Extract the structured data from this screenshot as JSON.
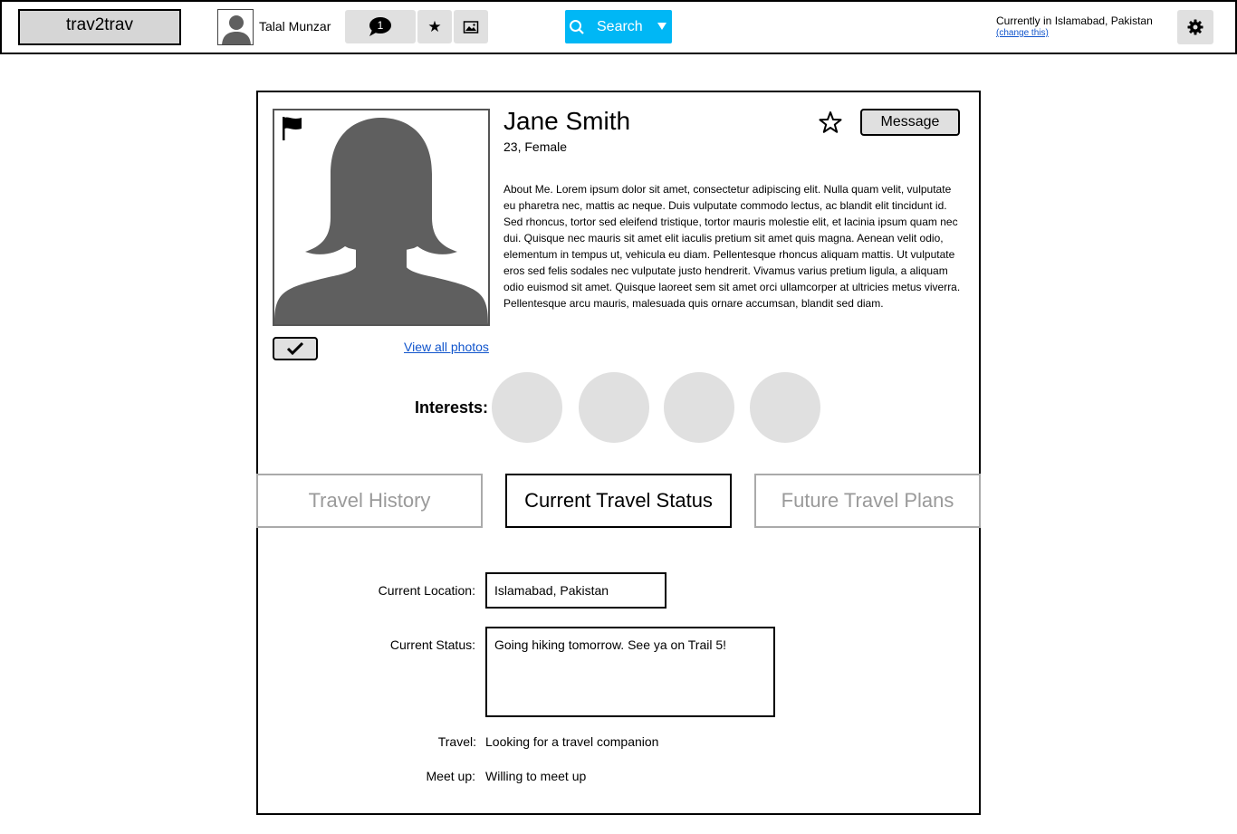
{
  "topbar": {
    "logo": "trav2trav",
    "user_name": "Talal Munzar",
    "message_count": "1",
    "search_label": "Search",
    "location_text": "Currently in Islamabad, Pakistan",
    "change_link": "(change this)"
  },
  "profile": {
    "name": "Jane Smith",
    "meta": "23, Female",
    "message_button": "Message",
    "view_photos": "View all photos",
    "about": "About Me. Lorem ipsum dolor sit amet, consectetur adipiscing elit. Nulla quam velit, vulputate eu pharetra nec, mattis ac neque. Duis vulputate commodo lectus, ac blandit elit tincidunt id. Sed rhoncus, tortor sed eleifend tristique, tortor mauris molestie elit, et lacinia ipsum quam nec dui. Quisque nec mauris sit amet elit iaculis pretium sit amet quis magna. Aenean velit odio, elementum in tempus ut, vehicula eu diam. Pellentesque rhoncus aliquam mattis. Ut vulputate eros sed felis sodales nec vulputate justo hendrerit. Vivamus varius pretium ligula, a aliquam odio euismod sit amet. Quisque laoreet sem sit amet orci ullamcorper at ultricies metus viverra. Pellentesque arcu mauris, malesuada quis ornare accumsan, blandit sed diam.",
    "interests_label": "Interests:"
  },
  "tabs": [
    {
      "label": "Travel History",
      "active": false
    },
    {
      "label": "Current Travel Status",
      "active": true
    },
    {
      "label": "Future Travel Plans",
      "active": false
    }
  ],
  "status_form": {
    "location_label": "Current Location:",
    "location_value": "Islamabad, Pakistan",
    "status_label": "Current Status:",
    "status_value": "Going hiking tomorrow. See ya on Trail 5!",
    "travel_label": "Travel:",
    "travel_value": "Looking for a travel companion",
    "meetup_label": "Meet up:",
    "meetup_value": "Willing to meet up"
  },
  "colors": {
    "search_accent": "#00b7f5",
    "button_gray": "#e0e0e0",
    "link": "#1155cc",
    "silhouette": "#5f5f5f"
  }
}
